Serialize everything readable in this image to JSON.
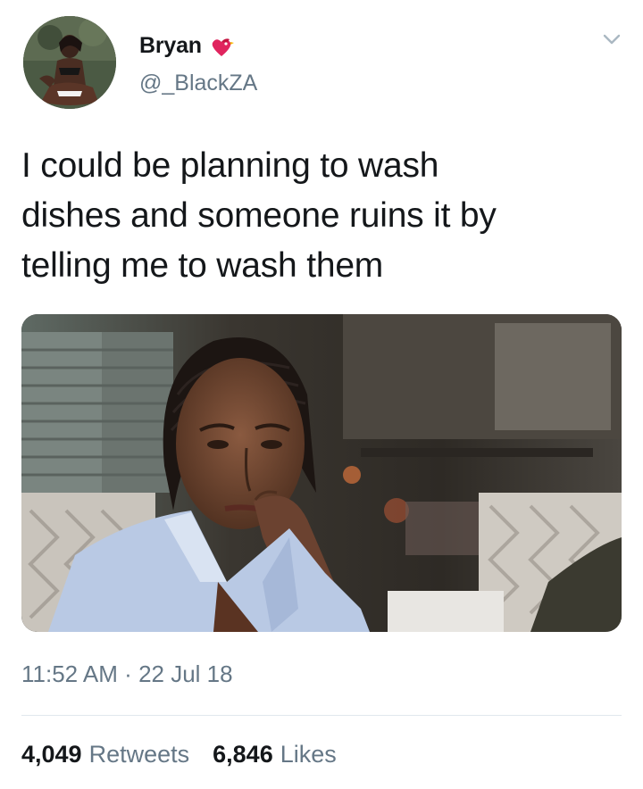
{
  "tweet": {
    "author": {
      "display_name": "Bryan",
      "handle": "@_BlackZA",
      "name_emoji": "heart-bird-emoji"
    },
    "text_lines": [
      "I could be planning to wash",
      "dishes and someone ruins it by",
      "telling me to wash them"
    ],
    "media": {
      "icon": "photo"
    },
    "time": "11:52 AM",
    "separator": "·",
    "date": "22 Jul 18",
    "stats": {
      "retweets_count": "4,049",
      "retweets_label": "Retweets",
      "likes_count": "6,846",
      "likes_label": "Likes"
    },
    "colors": {
      "text": "#14171a",
      "secondary": "#657786",
      "divider": "#e1e8ed",
      "emoji_red": "#e0245e"
    }
  }
}
